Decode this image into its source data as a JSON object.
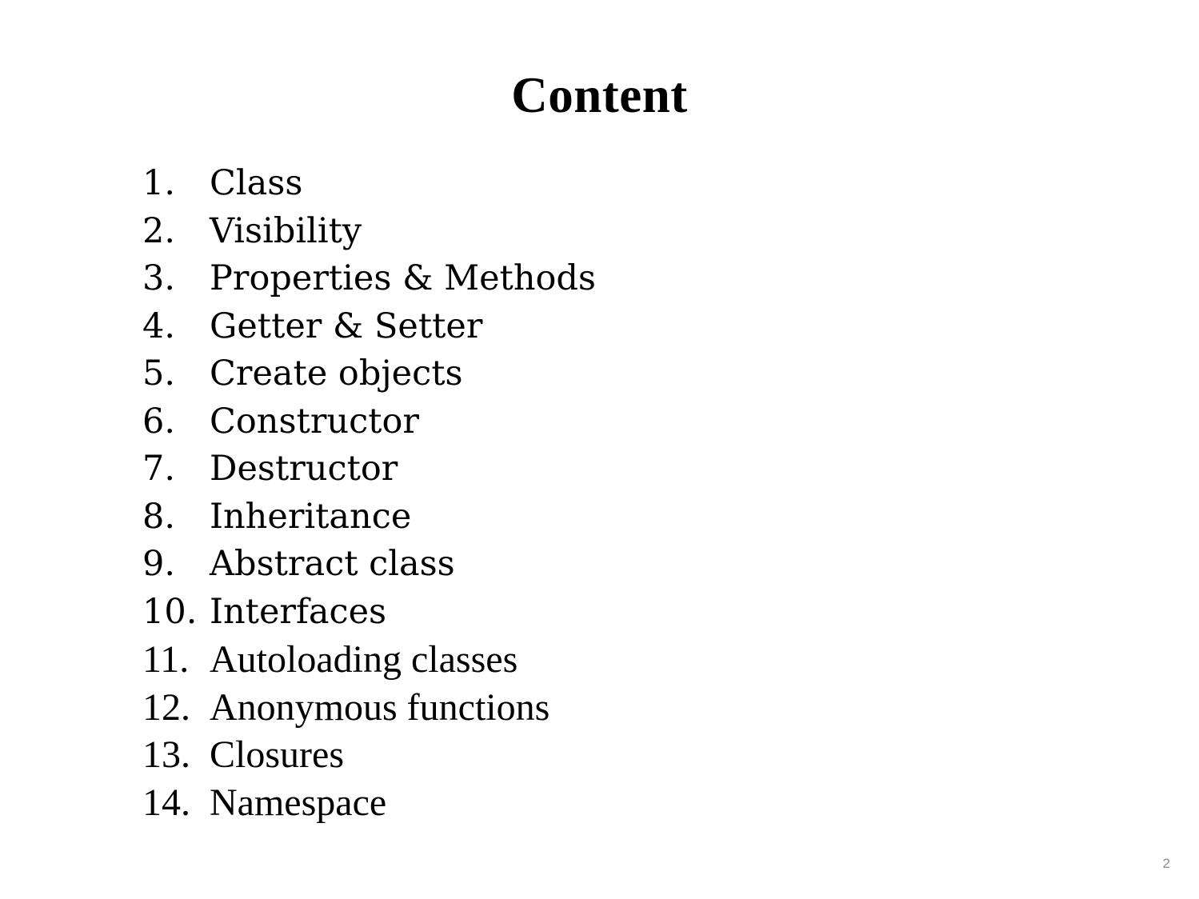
{
  "slide": {
    "title": "Content",
    "page_number": "2",
    "background_color": "#ffffff",
    "text_color": "#000000",
    "page_number_color": "#8a8a8a"
  },
  "content_list": [
    {
      "number": "1.",
      "label": "Class"
    },
    {
      "number": "2.",
      "label": "Visibility"
    },
    {
      "number": "3.",
      "label": "Properties & Methods"
    },
    {
      "number": "4.",
      "label": "Getter & Setter"
    },
    {
      "number": "5.",
      "label": "Create objects"
    },
    {
      "number": "6.",
      "label": "Constructor"
    },
    {
      "number": "7.",
      "label": "Destructor"
    },
    {
      "number": "8.",
      "label": "Inheritance"
    },
    {
      "number": "9.",
      "label": "Abstract class"
    },
    {
      "number": "10.",
      "label": "Interfaces"
    },
    {
      "number": "11.",
      "label": "Autoloading classes"
    },
    {
      "number": "12.",
      "label": "Anonymous functions"
    },
    {
      "number": "13.",
      "label": "Closures"
    },
    {
      "number": "14.",
      "label": "Namespace"
    }
  ]
}
